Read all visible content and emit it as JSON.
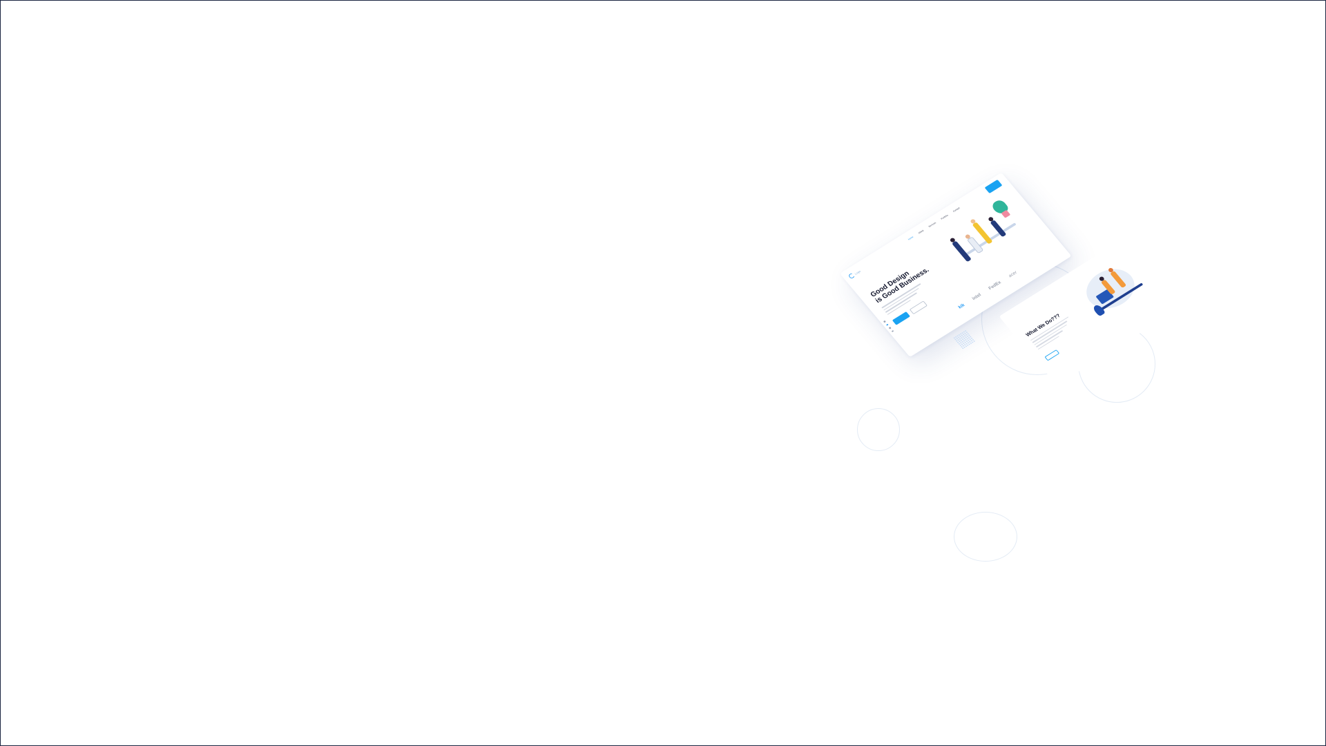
{
  "mockup": {
    "logo_text": "Logo",
    "nav": {
      "links": [
        "Home",
        "About",
        "Services",
        "Portfolio",
        "Contact"
      ],
      "cta_label": ""
    },
    "hero": {
      "title_line1": "Good Design",
      "title_line2": "is Good Business.",
      "primary_button": "",
      "secondary_button": ""
    },
    "brands": [
      "kik",
      "intel",
      "FedEx",
      "acer"
    ],
    "section": {
      "title": "What We Do???",
      "button": ""
    }
  },
  "colors": {
    "accent": "#1aa3f2",
    "heading": "#14182e",
    "border": "#1a2440"
  }
}
